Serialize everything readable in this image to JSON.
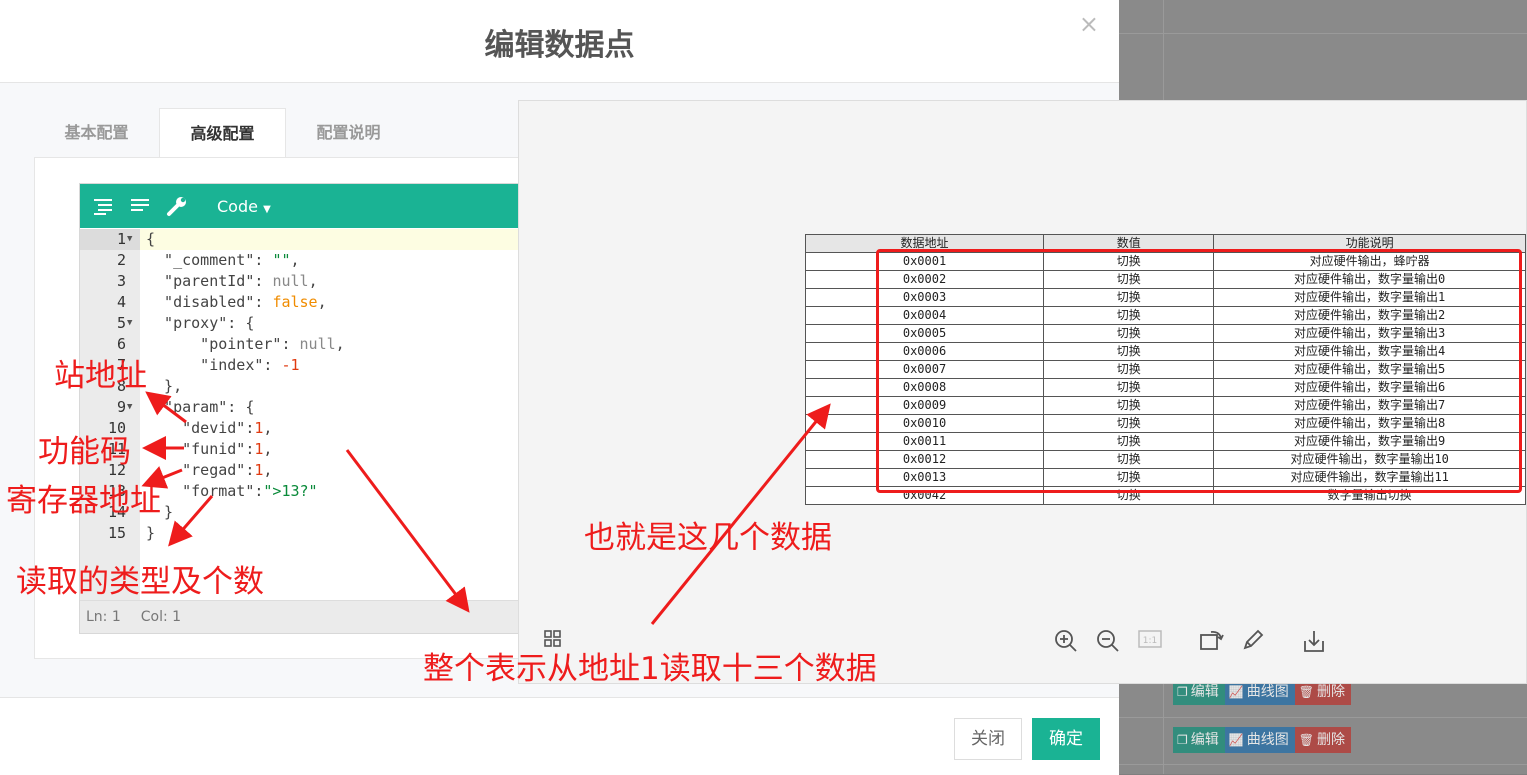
{
  "modal": {
    "title": "编辑数据点",
    "close_icon": "×",
    "tabs": [
      "基本配置",
      "高级配置",
      "配置说明"
    ],
    "active_tab": 1
  },
  "editor": {
    "mode_label": "Code",
    "status": {
      "ln": "Ln: 1",
      "col": "Col: 1"
    },
    "line_numbers": [
      "1",
      "2",
      "3",
      "4",
      "5",
      "6",
      "7",
      "8",
      "9",
      "10",
      "11",
      "12",
      "13",
      "14",
      "15"
    ]
  },
  "footer": {
    "close_label": "关闭",
    "ok_label": "确定"
  },
  "background_rows": [
    {
      "edit": "编辑",
      "curve": "曲线图",
      "del": "删除"
    },
    {
      "edit": "编辑",
      "curve": "曲线图",
      "del": "删除"
    }
  ],
  "table": {
    "headers": [
      "数据地址",
      "数值",
      "功能说明"
    ],
    "rows": [
      [
        "0x0001",
        "切换",
        "对应硬件输出，蜂咛器"
      ],
      [
        "0x0002",
        "切换",
        "对应硬件输出，数字量输出0"
      ],
      [
        "0x0003",
        "切换",
        "对应硬件输出，数字量输出1"
      ],
      [
        "0x0004",
        "切换",
        "对应硬件输出，数字量输出2"
      ],
      [
        "0x0005",
        "切换",
        "对应硬件输出，数字量输出3"
      ],
      [
        "0x0006",
        "切换",
        "对应硬件输出，数字量输出4"
      ],
      [
        "0x0007",
        "切换",
        "对应硬件输出，数字量输出5"
      ],
      [
        "0x0008",
        "切换",
        "对应硬件输出，数字量输出6"
      ],
      [
        "0x0009",
        "切换",
        "对应硬件输出，数字量输出7"
      ],
      [
        "0x0010",
        "切换",
        "对应硬件输出，数字量输出8"
      ],
      [
        "0x0011",
        "切换",
        "对应硬件输出，数字量输出9"
      ],
      [
        "0x0012",
        "切换",
        "对应硬件输出，数字量输出10"
      ],
      [
        "0x0013",
        "切换",
        "对应硬件输出，数字量输出11"
      ],
      [
        "0x0042",
        "切换",
        "数字量输出切换"
      ]
    ]
  },
  "annotations": {
    "station": "站地址",
    "funid": "功能码",
    "register": "寄存器地址",
    "type_count": "读取的类型及个数",
    "these_data": "也就是这几个数据",
    "summary": "整个表示从地址1读取十三个数据"
  },
  "colors": {
    "accent": "#1ab394",
    "annotation": "#ee1c1c"
  }
}
